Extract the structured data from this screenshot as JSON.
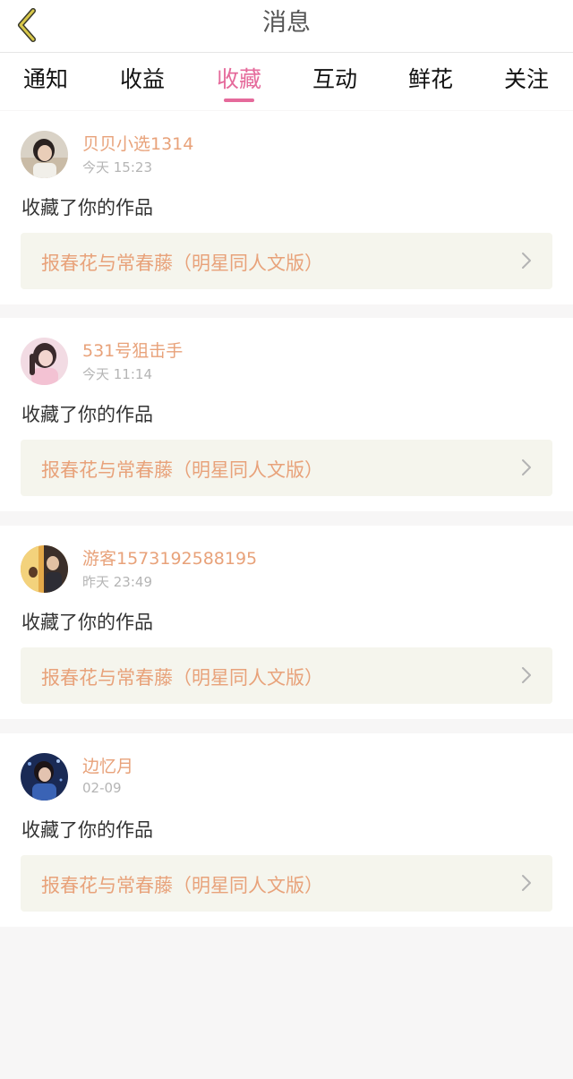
{
  "header": {
    "title": "消息"
  },
  "tabs": [
    {
      "label": "通知"
    },
    {
      "label": "收益"
    },
    {
      "label": "收藏"
    },
    {
      "label": "互动"
    },
    {
      "label": "鲜花"
    },
    {
      "label": "关注"
    }
  ],
  "active_tab": "收藏",
  "colors": {
    "accent": "#e56a9b",
    "username": "#e8a27a",
    "work_bg": "#f5f5ed"
  },
  "messages": [
    {
      "username": "贝贝小选1314",
      "time": "今天 15:23",
      "action": "收藏了你的作品",
      "work_title": "报春花与常春藤（明星同人文版）"
    },
    {
      "username": "531号狙击手",
      "time": "今天 11:14",
      "action": "收藏了你的作品",
      "work_title": "报春花与常春藤（明星同人文版）"
    },
    {
      "username": "游客1573192588195",
      "time": "昨天 23:49",
      "action": "收藏了你的作品",
      "work_title": "报春花与常春藤（明星同人文版）"
    },
    {
      "username": "边忆月",
      "time": "02-09",
      "action": "收藏了你的作品",
      "work_title": "报春花与常春藤（明星同人文版）"
    }
  ]
}
